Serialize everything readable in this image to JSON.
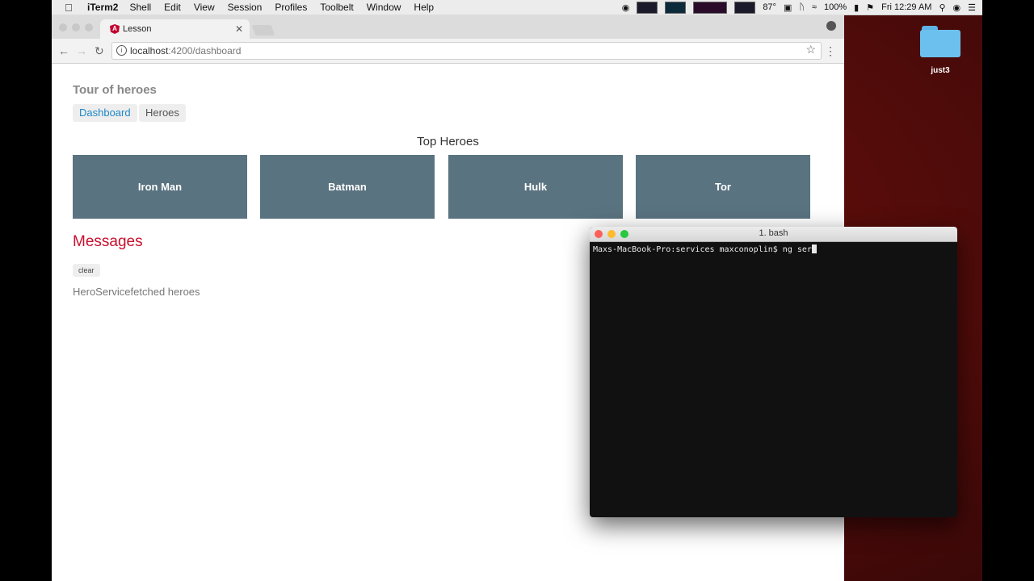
{
  "menubar": {
    "app": "iTerm2",
    "items": [
      "Shell",
      "Edit",
      "View",
      "Session",
      "Profiles",
      "Toolbelt",
      "Window",
      "Help"
    ],
    "temperature": "87°",
    "battery": "100%",
    "clock": "Fri 12:29 AM"
  },
  "desktop": {
    "folder_label": "just3"
  },
  "browser": {
    "tab_title": "Lesson",
    "url_host": "localhost",
    "url_rest": ":4200/dashboard"
  },
  "page": {
    "app_title": "Tour of heroes",
    "nav": {
      "dashboard": "Dashboard",
      "heroes": "Heroes"
    },
    "top_heroes_heading": "Top Heroes",
    "heroes": [
      "Iron Man",
      "Batman",
      "Hulk",
      "Tor"
    ],
    "messages_heading": "Messages",
    "clear_label": "clear",
    "messages": [
      "HeroServicefetched heroes"
    ]
  },
  "terminal": {
    "title": "1. bash",
    "prompt": "Maxs-MacBook-Pro:services maxconoplin$ ng ser"
  },
  "colors": {
    "hero_card": "#5a7380",
    "messages_heading": "#c8102e",
    "link_blue": "#1e88c7"
  }
}
